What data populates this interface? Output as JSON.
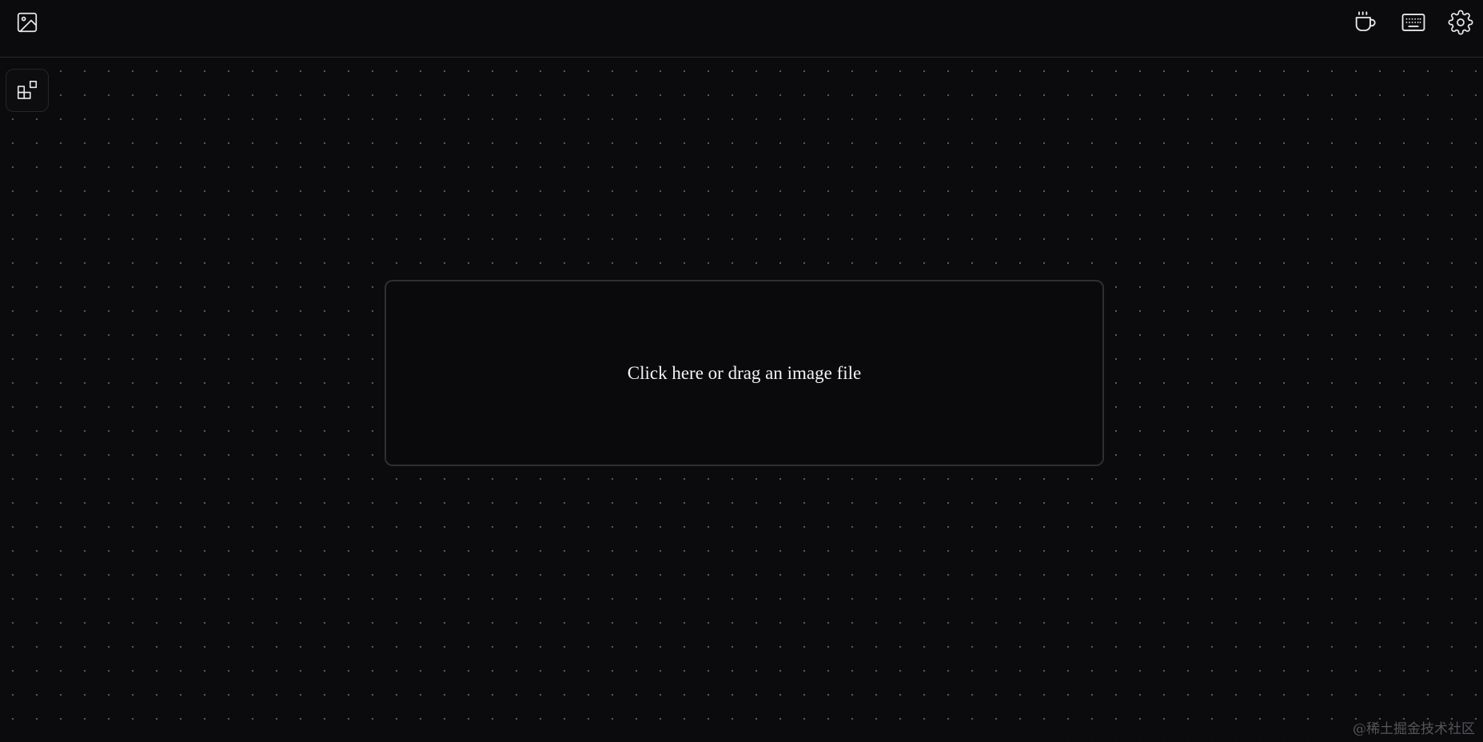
{
  "toolbar": {
    "left_icon": "image-icon",
    "right_icons": [
      "coffee-cup-icon",
      "keyboard-icon",
      "gear-icon"
    ]
  },
  "sidebar": {
    "toggle_icon": "layers-icon"
  },
  "dropzone": {
    "label": "Click here or drag an image file"
  },
  "watermark": {
    "text": "@稀土掘金技术社区"
  },
  "colors": {
    "background": "#0b0b0d",
    "dot_grid": "#5c5c60",
    "border": "#2f2f33",
    "text": "#f2f2f2"
  }
}
